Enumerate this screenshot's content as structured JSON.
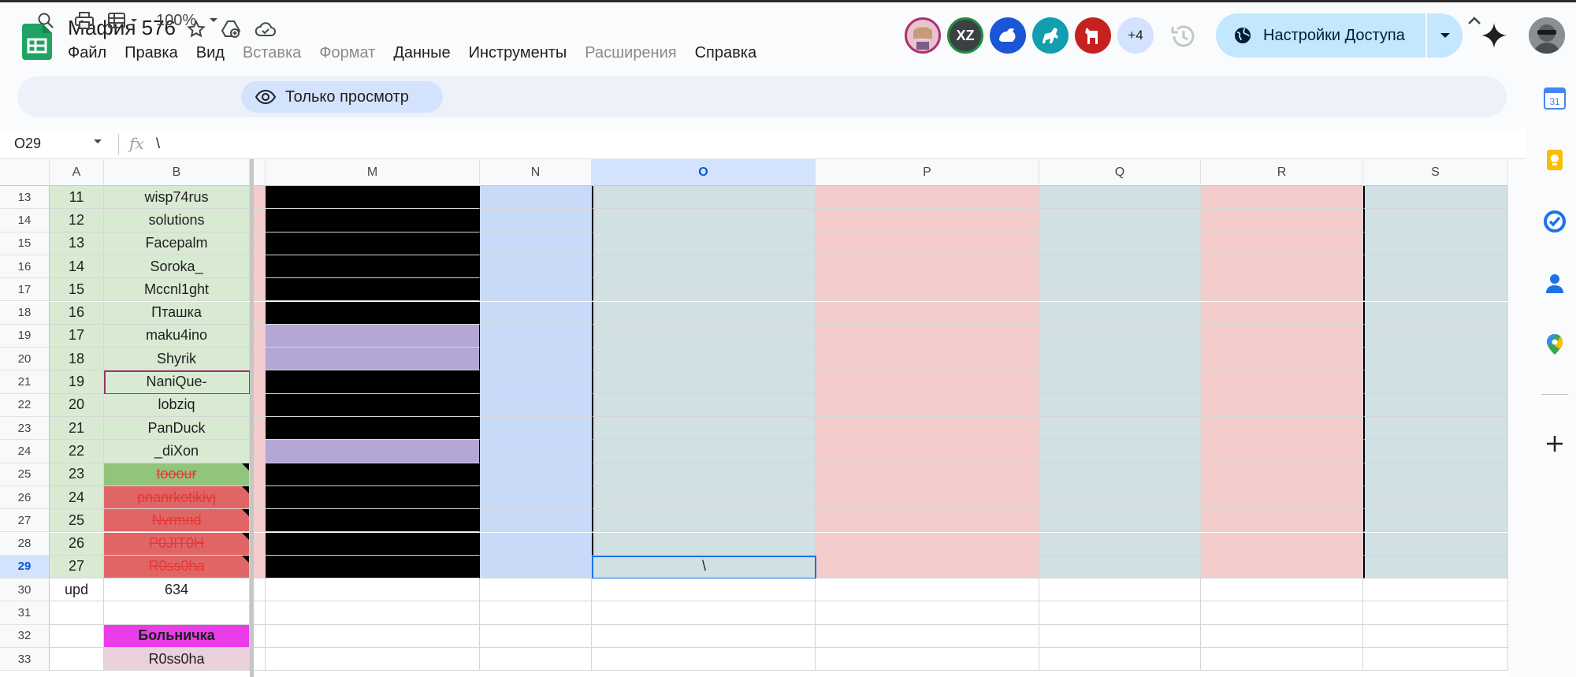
{
  "document": {
    "title": "Мафия 576"
  },
  "menu": [
    "Файл",
    "Правка",
    "Вид",
    "Вставка",
    "Формат",
    "Данные",
    "Инструменты",
    "Расширения",
    "Справка"
  ],
  "menu_disabled": [
    false,
    false,
    false,
    true,
    true,
    false,
    false,
    true,
    false
  ],
  "collaborators": {
    "initials_avatar": "XZ",
    "more_count": "+4"
  },
  "share": {
    "label": "Настройки Доступа"
  },
  "toolbar": {
    "zoom": "100%",
    "view_only_label": "Только просмотр"
  },
  "formula_bar": {
    "name_box": "O29",
    "fx": "fx",
    "value": "\\"
  },
  "columns": {
    "frozen": [
      "A",
      "B"
    ],
    "scrolled": [
      "M",
      "N",
      "O",
      "P",
      "Q",
      "R",
      "S"
    ],
    "selected": "O"
  },
  "rows": [
    {
      "row": "13",
      "a": "11",
      "b": "wisp74rus",
      "b_style": "green",
      "m": "black"
    },
    {
      "row": "14",
      "a": "12",
      "b": "solutions",
      "b_style": "green",
      "m": "black"
    },
    {
      "row": "15",
      "a": "13",
      "b": "Facepalm",
      "b_style": "green",
      "m": "black"
    },
    {
      "row": "16",
      "a": "14",
      "b": "Soroka_",
      "b_style": "green",
      "m": "black"
    },
    {
      "row": "17",
      "a": "15",
      "b": "Mccnl1ght",
      "b_style": "green",
      "m": "black"
    },
    {
      "row": "18",
      "a": "16",
      "b": "Пташка",
      "b_style": "green",
      "m": "black"
    },
    {
      "row": "19",
      "a": "17",
      "b": "maku4ino",
      "b_style": "green",
      "m": "purple"
    },
    {
      "row": "20",
      "a": "18",
      "b": "Shyrik",
      "b_style": "green",
      "m": "purple"
    },
    {
      "row": "21",
      "a": "19",
      "b": "NaniQue-",
      "b_style": "green",
      "m": "black"
    },
    {
      "row": "22",
      "a": "20",
      "b": "lobziq",
      "b_style": "green",
      "m": "black"
    },
    {
      "row": "23",
      "a": "21",
      "b": "PanDuck",
      "b_style": "green",
      "m": "black"
    },
    {
      "row": "24",
      "a": "22",
      "b": "_diXon",
      "b_style": "green",
      "m": "purple"
    },
    {
      "row": "25",
      "a": "23",
      "b": "tooour",
      "b_style": "dkgreen",
      "m": "black"
    },
    {
      "row": "26",
      "a": "24",
      "b": "pnanrkotikivj",
      "b_style": "red",
      "m": "black"
    },
    {
      "row": "27",
      "a": "25",
      "b": "Nvrmnd",
      "b_style": "red",
      "m": "black"
    },
    {
      "row": "28",
      "a": "26",
      "b": "P0JIT0H",
      "b_style": "red",
      "m": "black"
    },
    {
      "row": "29",
      "a": "27",
      "b": "R0ss0ha",
      "b_style": "red",
      "m": "black",
      "o": "\\"
    },
    {
      "row": "30",
      "a": "upd",
      "b": "634",
      "b_style": "white",
      "m": "white"
    },
    {
      "row": "31",
      "a": "",
      "b": "",
      "b_style": "white",
      "m": "white"
    },
    {
      "row": "32",
      "a": "",
      "b": "Больничка",
      "b_style": "magenta",
      "m": "white"
    },
    {
      "row": "33",
      "a": "",
      "b": "R0ss0ha",
      "b_style": "pink",
      "m": "white"
    }
  ],
  "colors": {
    "green": "#d9ead3",
    "dkgreen": "#93c47d",
    "red": "#e06666",
    "magenta": "#ea3ce8",
    "pink": "#ead1dc",
    "purple": "#b4a7d6",
    "col_n": "#c9daf8",
    "col_o": "#d0e0e3",
    "col_p": "#f4cccc",
    "col_q": "#d0e0e3",
    "col_r": "#f4cccc",
    "col_s": "#d0e0e3",
    "strike_text": "#e53935",
    "accent": "#0b57d0"
  }
}
